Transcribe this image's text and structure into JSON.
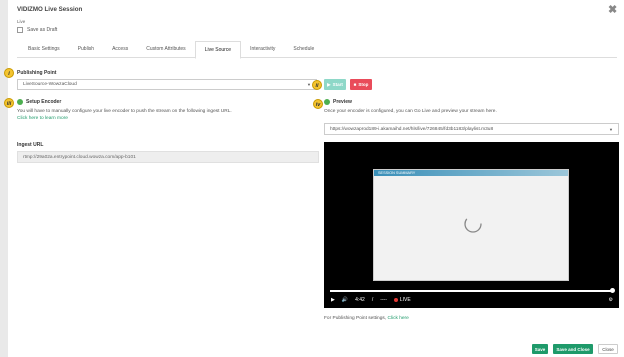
{
  "header": {
    "title": "VIDIZMO Live Session",
    "subtitle": "Live",
    "save_as_draft_label": "Save as Draft"
  },
  "tabs": [
    {
      "label": "Basic Settings"
    },
    {
      "label": "Publish"
    },
    {
      "label": "Access"
    },
    {
      "label": "Custom Attributes"
    },
    {
      "label": "Live Source"
    },
    {
      "label": "Interactivity"
    },
    {
      "label": "Schedule"
    }
  ],
  "active_tab": "Live Source",
  "markers": {
    "i": "i",
    "ii": "ii",
    "iii": "iii",
    "iv": "iv"
  },
  "publishing_point": {
    "label": "Publishing Point",
    "selected": "LiveSource-WowzaCloud",
    "start_label": "Start",
    "stop_label": "Stop"
  },
  "setup_encoder": {
    "title": "Setup Encoder",
    "description": "You will have to manually configure your live encoder to push the stream on the following ingest URL.",
    "learn_more": "Click here to learn more",
    "ingest_label": "Ingest URL",
    "ingest_value": "rtmp://29a02a.entrypoint.cloud.wowza.com/app-b101"
  },
  "preview": {
    "title": "Preview",
    "description": "Once your encoder is configured, you can Go Live and preview your stream here.",
    "stream_url": "https://wowzaprod189-i.akamaihd.net/hls/live/726845/fd3b1183/playlist.m3u8",
    "slide_header": "SESSION SUMMARY",
    "time_current": "4:42",
    "time_sep": "/",
    "time_total": "----",
    "live_label": "LIVE",
    "publishing_note": "For Publishing Point settings,",
    "publishing_link": "Click here"
  },
  "footer": {
    "save": "Save",
    "save_and_close": "Save and Close",
    "close": "Close"
  },
  "colors": {
    "accent": "#1e9a6a",
    "stop": "#e94b5a",
    "start": "#8ed8c8",
    "marker": "#f4c430",
    "live_dot": "#e53935"
  }
}
